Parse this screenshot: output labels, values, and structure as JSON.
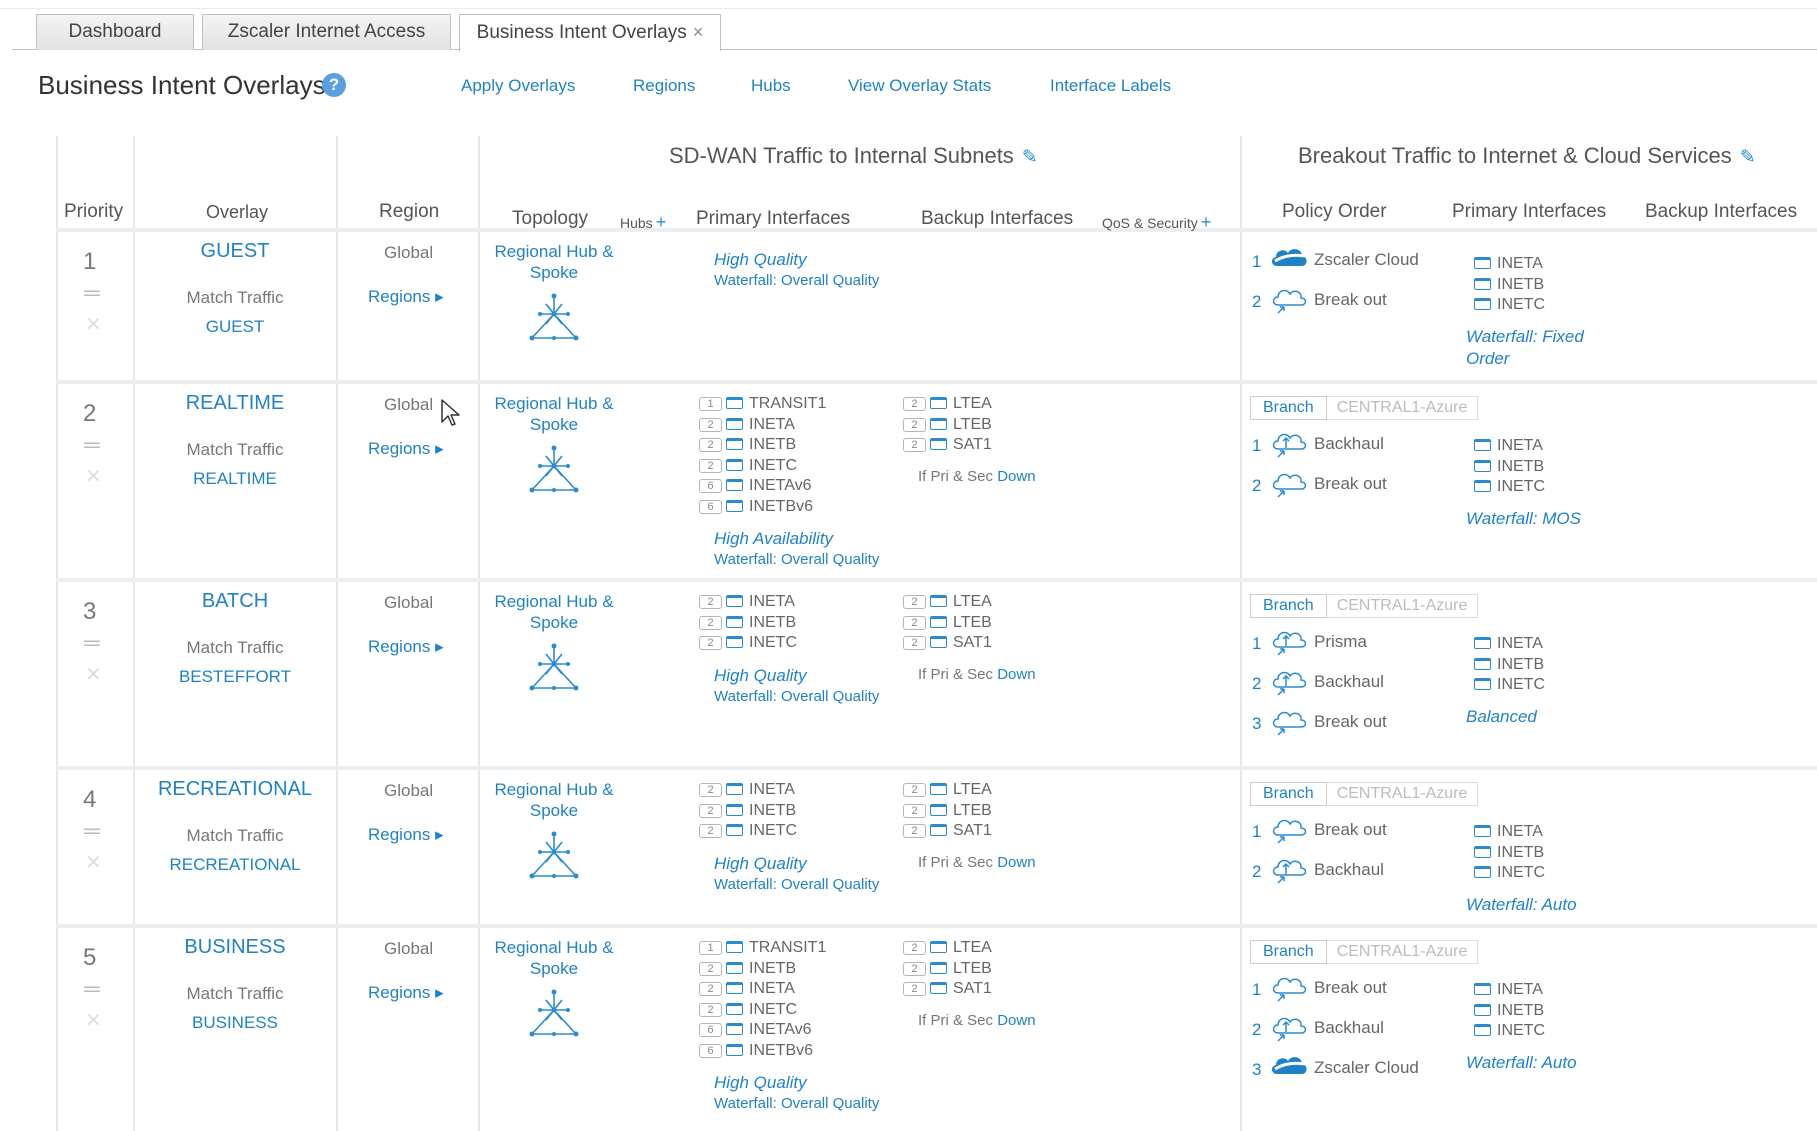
{
  "tabs": [
    {
      "label": "Dashboard"
    },
    {
      "label": "Zscaler Internet Access"
    },
    {
      "label": "Business Intent Overlays",
      "close": "×"
    }
  ],
  "header": {
    "title": "Business Intent Overlays",
    "help": "?",
    "links": [
      "Apply Overlays",
      "Regions",
      "Hubs",
      "View Overlay Stats",
      "Interface Labels"
    ]
  },
  "groups": {
    "sdwan": "SD-WAN Traffic to Internal Subnets",
    "breakout": "Breakout Traffic to Internet & Cloud Services",
    "edit_icon": "pencil-icon"
  },
  "columns": {
    "priority": "Priority",
    "overlay": "Overlay",
    "region": "Region",
    "topology": "Topology",
    "hubs": "Hubs",
    "primary": "Primary Interfaces",
    "backup": "Backup Interfaces",
    "qos": "QoS & Security",
    "policy_order": "Policy Order",
    "b_primary": "Primary Interfaces",
    "b_backup": "Backup Interfaces"
  },
  "common": {
    "match_traffic": "Match Traffic",
    "global": "Global",
    "regions_link": "Regions ▸",
    "topology": "Regional Hub &\nSpoke",
    "if_down_prefix": "If Pri & Sec ",
    "if_down_link": "Down",
    "branch_tab": "Branch",
    "central_tab": "CENTRAL1-Azure"
  },
  "rows": [
    {
      "priority": "1",
      "name": "GUEST",
      "match": "GUEST",
      "primary": [],
      "quality": "High Quality",
      "waterfall": "Waterfall: Overall Quality",
      "backup": [],
      "show_breakout_tabs": false,
      "policies": [
        {
          "n": "1",
          "label": "Zscaler Cloud",
          "icon": "zscaler-cloud-icon"
        },
        {
          "n": "2",
          "label": "Break out",
          "icon": "cloud-breakout-icon"
        }
      ],
      "b_primary": [
        "INETA",
        "INETB",
        "INETC"
      ],
      "b_waterfall": "Waterfall: Fixed\nOrder"
    },
    {
      "priority": "2",
      "name": "REALTIME",
      "match": "REALTIME",
      "primary": [
        {
          "n": "1",
          "name": "TRANSIT1"
        },
        {
          "n": "2",
          "name": "INETA"
        },
        {
          "n": "2",
          "name": "INETB"
        },
        {
          "n": "2",
          "name": "INETC"
        },
        {
          "n": "6",
          "name": "INETAv6"
        },
        {
          "n": "6",
          "name": "INETBv6"
        }
      ],
      "quality": "High Availability",
      "waterfall": "Waterfall: Overall Quality",
      "backup": [
        {
          "n": "2",
          "name": "LTEA"
        },
        {
          "n": "2",
          "name": "LTEB"
        },
        {
          "n": "2",
          "name": "SAT1"
        }
      ],
      "show_breakout_tabs": true,
      "policies": [
        {
          "n": "1",
          "label": "Backhaul",
          "icon": "cloud-backhaul-icon"
        },
        {
          "n": "2",
          "label": "Break out",
          "icon": "cloud-breakout-icon"
        }
      ],
      "b_primary": [
        "INETA",
        "INETB",
        "INETC"
      ],
      "b_waterfall": "Waterfall: MOS"
    },
    {
      "priority": "3",
      "name": "BATCH",
      "match": "BESTEFFORT",
      "primary": [
        {
          "n": "2",
          "name": "INETA"
        },
        {
          "n": "2",
          "name": "INETB"
        },
        {
          "n": "2",
          "name": "INETC"
        }
      ],
      "quality": "High Quality",
      "waterfall": "Waterfall: Overall Quality",
      "backup": [
        {
          "n": "2",
          "name": "LTEA"
        },
        {
          "n": "2",
          "name": "LTEB"
        },
        {
          "n": "2",
          "name": "SAT1"
        }
      ],
      "show_breakout_tabs": true,
      "policies": [
        {
          "n": "1",
          "label": "Prisma",
          "icon": "cloud-service-icon"
        },
        {
          "n": "2",
          "label": "Backhaul",
          "icon": "cloud-backhaul-icon"
        },
        {
          "n": "3",
          "label": "Break out",
          "icon": "cloud-breakout-icon"
        }
      ],
      "b_primary": [
        "INETA",
        "INETB",
        "INETC"
      ],
      "b_waterfall": "Balanced"
    },
    {
      "priority": "4",
      "name": "RECREATIONAL",
      "match": "RECREATIONAL",
      "primary": [
        {
          "n": "2",
          "name": "INETA"
        },
        {
          "n": "2",
          "name": "INETB"
        },
        {
          "n": "2",
          "name": "INETC"
        }
      ],
      "quality": "High Quality",
      "waterfall": "Waterfall: Overall Quality",
      "backup": [
        {
          "n": "2",
          "name": "LTEA"
        },
        {
          "n": "2",
          "name": "LTEB"
        },
        {
          "n": "2",
          "name": "SAT1"
        }
      ],
      "show_breakout_tabs": true,
      "policies": [
        {
          "n": "1",
          "label": "Break out",
          "icon": "cloud-breakout-icon"
        },
        {
          "n": "2",
          "label": "Backhaul",
          "icon": "cloud-backhaul-icon"
        }
      ],
      "b_primary": [
        "INETA",
        "INETB",
        "INETC"
      ],
      "b_waterfall": "Waterfall: Auto"
    },
    {
      "priority": "5",
      "name": "BUSINESS",
      "match": "BUSINESS",
      "primary": [
        {
          "n": "1",
          "name": "TRANSIT1"
        },
        {
          "n": "2",
          "name": "INETB"
        },
        {
          "n": "2",
          "name": "INETA"
        },
        {
          "n": "2",
          "name": "INETC"
        },
        {
          "n": "6",
          "name": "INETAv6"
        },
        {
          "n": "6",
          "name": "INETBv6"
        }
      ],
      "quality": "High Quality",
      "waterfall": "Waterfall: Overall Quality",
      "backup": [
        {
          "n": "2",
          "name": "LTEA"
        },
        {
          "n": "2",
          "name": "LTEB"
        },
        {
          "n": "2",
          "name": "SAT1"
        }
      ],
      "show_breakout_tabs": true,
      "policies": [
        {
          "n": "1",
          "label": "Break out",
          "icon": "cloud-breakout-icon"
        },
        {
          "n": "2",
          "label": "Backhaul",
          "icon": "cloud-backhaul-icon"
        },
        {
          "n": "3",
          "label": "Zscaler Cloud",
          "icon": "zscaler-cloud-icon"
        }
      ],
      "b_primary": [
        "INETA",
        "INETB",
        "INETC"
      ],
      "b_waterfall": "Waterfall: Auto"
    }
  ],
  "icons": {
    "drag": "drag-handle-icon",
    "delete": "delete-x-icon",
    "topology": "hub-spoke-topology-icon",
    "cursor": "mouse-pointer-icon"
  },
  "colors": {
    "accent": "#1f82c8",
    "help": "#5a9fe0"
  }
}
